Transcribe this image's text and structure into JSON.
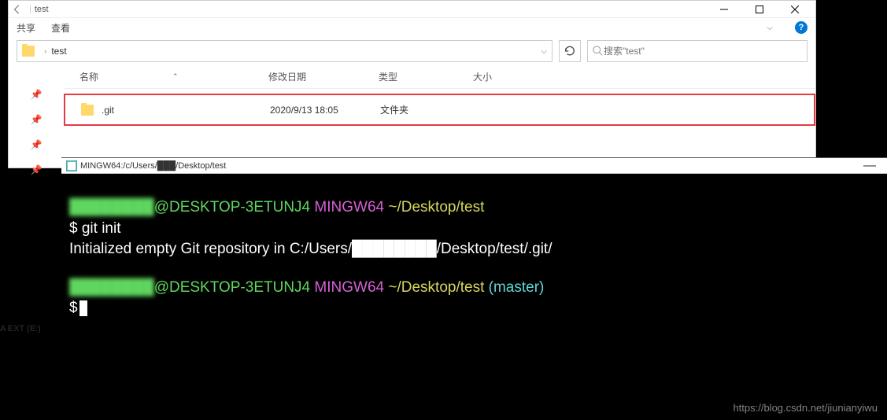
{
  "explorer": {
    "title": "test",
    "tabs": {
      "share": "共享",
      "view": "查看"
    },
    "breadcrumb": {
      "folder": "test"
    },
    "search_placeholder": "搜索\"test\"",
    "columns": {
      "name": "名称",
      "date": "修改日期",
      "type": "类型",
      "size": "大小"
    },
    "files": [
      {
        "name": ".git",
        "date": "2020/9/13 18:05",
        "type": "文件夹",
        "size": ""
      }
    ],
    "sidebar_drive": "A EXT (E:)"
  },
  "terminal": {
    "title": "MINGW64:/c/Users/███/Desktop/test",
    "lines": {
      "user1": "████████",
      "host1": "@DESKTOP-3ETUNJ4",
      "env1": "MINGW64",
      "path1": "~/Desktop/test",
      "prompt1": "$ ",
      "cmd1": "git init",
      "output1": "Initialized empty Git repository in C:/Users/████████/Desktop/test/.git/",
      "user2": "████████",
      "host2": "@DESKTOP-3ETUNJ4",
      "env2": "MINGW64",
      "path2": "~/Desktop/test",
      "branch2": "(master)",
      "prompt2": "$"
    }
  },
  "watermark": "https://blog.csdn.net/jiunianyiwu"
}
